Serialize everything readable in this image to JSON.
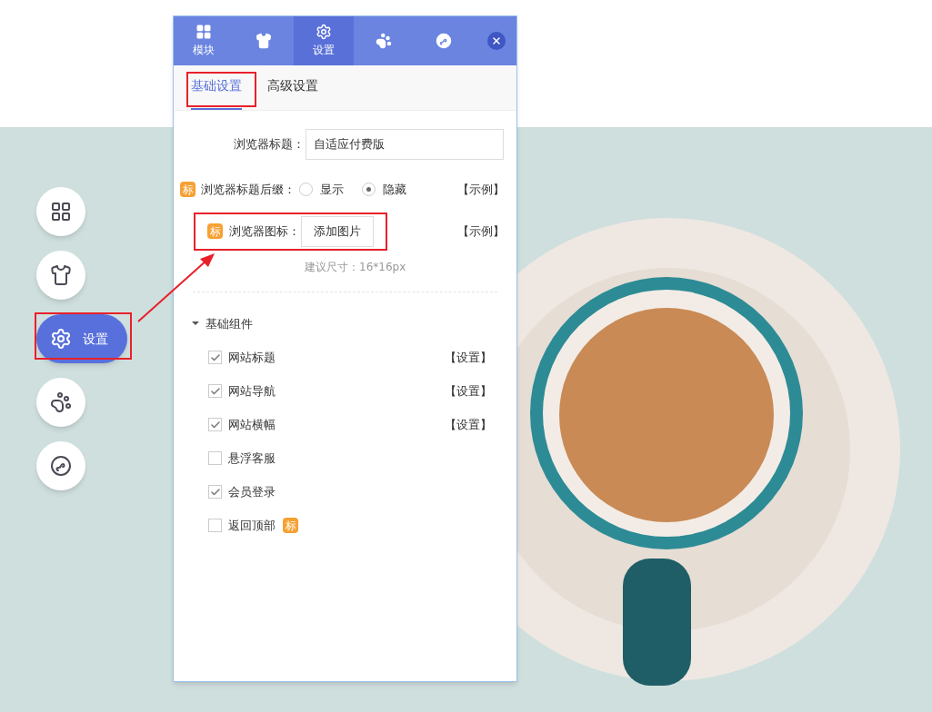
{
  "panel": {
    "tabs": [
      {
        "label": "模块",
        "selected": false
      },
      {
        "selected": false
      },
      {
        "label": "设置",
        "selected": true
      },
      {
        "selected": false
      },
      {
        "selected": false
      }
    ],
    "subtabs": [
      {
        "label": "基础设置",
        "selected": true
      },
      {
        "label": "高级设置",
        "selected": false
      }
    ],
    "form": {
      "title": {
        "label": "浏览器标题：",
        "value": "自适应付费版"
      },
      "suffix": {
        "badge": "标",
        "label": "浏览器标题后缀：",
        "options": [
          {
            "label": "显示",
            "selected": false
          },
          {
            "label": "隐藏",
            "selected": true
          }
        ],
        "link": "【示例】"
      },
      "favicon": {
        "badge": "标",
        "label": "浏览器图标：",
        "button": "添加图片",
        "link": "【示例】",
        "hint": "建议尺寸：16*16px"
      }
    },
    "section": {
      "title": "基础组件",
      "expanded": true,
      "items": [
        {
          "label": "网站标题",
          "checked": true,
          "action": "【设置】"
        },
        {
          "label": "网站导航",
          "checked": true,
          "action": "【设置】"
        },
        {
          "label": "网站横幅",
          "checked": true,
          "action": "【设置】"
        },
        {
          "label": "悬浮客服",
          "checked": false
        },
        {
          "label": "会员登录",
          "checked": true
        },
        {
          "label": "返回顶部",
          "checked": false,
          "badge": "标"
        }
      ]
    }
  },
  "side_menu": [
    {
      "selected": false
    },
    {
      "selected": false
    },
    {
      "label": "设置",
      "selected": true
    },
    {
      "selected": false
    },
    {
      "selected": false
    }
  ]
}
